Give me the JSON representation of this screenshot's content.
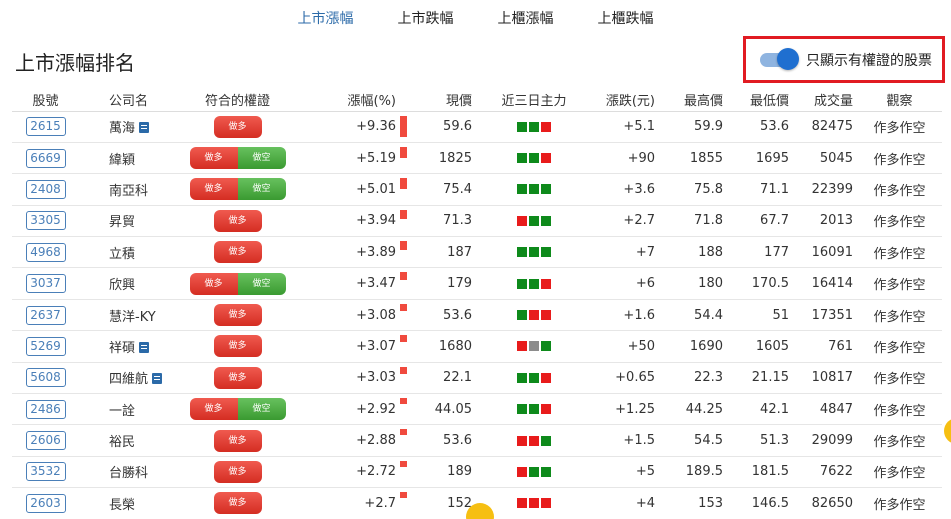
{
  "nav": {
    "tabs": [
      {
        "label": "上市漲幅",
        "active": true
      },
      {
        "label": "上市跌幅",
        "active": false
      },
      {
        "label": "上櫃漲幅",
        "active": false
      },
      {
        "label": "上櫃跌幅",
        "active": false
      }
    ]
  },
  "page_title": "上市漲幅排名",
  "toggle": {
    "label": "只顯示有權證的股票",
    "on": true
  },
  "table": {
    "headers": {
      "code": "股號",
      "name": "公司名",
      "warrant": "符合的權證",
      "pct": "漲幅(%)",
      "price": "現價",
      "main": "近三日主力",
      "chg": "漲跌(元)",
      "high": "最高價",
      "low": "最低價",
      "vol": "成交量",
      "view": "觀察"
    },
    "long_label": "做多",
    "short_label": "做空",
    "rows": [
      {
        "code": "2615",
        "name": "萬海",
        "doc": true,
        "warrants": [
          "long"
        ],
        "pct": "+9.36",
        "pct_value": 9.36,
        "price": "59.6",
        "main": [
          "g",
          "g",
          "r"
        ],
        "chg": "+5.1",
        "high": "59.9",
        "low": "53.6",
        "vol": "82475",
        "view": "作多作空"
      },
      {
        "code": "6669",
        "name": "緯穎",
        "doc": false,
        "warrants": [
          "long",
          "short"
        ],
        "pct": "+5.19",
        "pct_value": 5.19,
        "price": "1825",
        "main": [
          "g",
          "g",
          "r"
        ],
        "chg": "+90",
        "high": "1855",
        "low": "1695",
        "vol": "5045",
        "view": "作多作空"
      },
      {
        "code": "2408",
        "name": "南亞科",
        "doc": false,
        "warrants": [
          "long",
          "short"
        ],
        "pct": "+5.01",
        "pct_value": 5.01,
        "price": "75.4",
        "main": [
          "g",
          "g",
          "g"
        ],
        "chg": "+3.6",
        "high": "75.8",
        "low": "71.1",
        "vol": "22399",
        "view": "作多作空"
      },
      {
        "code": "3305",
        "name": "昇貿",
        "doc": false,
        "warrants": [
          "long"
        ],
        "pct": "+3.94",
        "pct_value": 3.94,
        "price": "71.3",
        "main": [
          "r",
          "g",
          "g"
        ],
        "chg": "+2.7",
        "high": "71.8",
        "low": "67.7",
        "vol": "2013",
        "view": "作多作空"
      },
      {
        "code": "4968",
        "name": "立積",
        "doc": false,
        "warrants": [
          "long"
        ],
        "pct": "+3.89",
        "pct_value": 3.89,
        "price": "187",
        "main": [
          "g",
          "g",
          "g"
        ],
        "chg": "+7",
        "high": "188",
        "low": "177",
        "vol": "16091",
        "view": "作多作空"
      },
      {
        "code": "3037",
        "name": "欣興",
        "doc": false,
        "warrants": [
          "long",
          "short"
        ],
        "pct": "+3.47",
        "pct_value": 3.47,
        "price": "179",
        "main": [
          "g",
          "g",
          "r"
        ],
        "chg": "+6",
        "high": "180",
        "low": "170.5",
        "vol": "16414",
        "view": "作多作空"
      },
      {
        "code": "2637",
        "name": "慧洋-KY",
        "doc": false,
        "warrants": [
          "long"
        ],
        "pct": "+3.08",
        "pct_value": 3.08,
        "price": "53.6",
        "main": [
          "g",
          "r",
          "r"
        ],
        "chg": "+1.6",
        "high": "54.4",
        "low": "51",
        "vol": "17351",
        "view": "作多作空"
      },
      {
        "code": "5269",
        "name": "祥碩",
        "doc": true,
        "warrants": [
          "long"
        ],
        "pct": "+3.07",
        "pct_value": 3.07,
        "price": "1680",
        "main": [
          "r",
          "gr",
          "g"
        ],
        "chg": "+50",
        "high": "1690",
        "low": "1605",
        "vol": "761",
        "view": "作多作空"
      },
      {
        "code": "5608",
        "name": "四維航",
        "doc": true,
        "warrants": [
          "long"
        ],
        "pct": "+3.03",
        "pct_value": 3.03,
        "price": "22.1",
        "main": [
          "g",
          "g",
          "r"
        ],
        "chg": "+0.65",
        "high": "22.3",
        "low": "21.15",
        "vol": "10817",
        "view": "作多作空"
      },
      {
        "code": "2486",
        "name": "一詮",
        "doc": false,
        "warrants": [
          "long",
          "short"
        ],
        "pct": "+2.92",
        "pct_value": 2.92,
        "price": "44.05",
        "main": [
          "g",
          "g",
          "r"
        ],
        "chg": "+1.25",
        "high": "44.25",
        "low": "42.1",
        "vol": "4847",
        "view": "作多作空"
      },
      {
        "code": "2606",
        "name": "裕民",
        "doc": false,
        "warrants": [
          "long"
        ],
        "pct": "+2.88",
        "pct_value": 2.88,
        "price": "53.6",
        "main": [
          "r",
          "r",
          "g"
        ],
        "chg": "+1.5",
        "high": "54.5",
        "low": "51.3",
        "vol": "29099",
        "view": "作多作空"
      },
      {
        "code": "3532",
        "name": "台勝科",
        "doc": false,
        "warrants": [
          "long"
        ],
        "pct": "+2.72",
        "pct_value": 2.72,
        "price": "189",
        "main": [
          "r",
          "g",
          "g"
        ],
        "chg": "+5",
        "high": "189.5",
        "low": "181.5",
        "vol": "7622",
        "view": "作多作空"
      },
      {
        "code": "2603",
        "name": "長榮",
        "doc": false,
        "warrants": [
          "long"
        ],
        "pct": "+2.7",
        "pct_value": 2.7,
        "price": "152",
        "main": [
          "r",
          "r",
          "r"
        ],
        "chg": "+4",
        "high": "153",
        "low": "146.5",
        "vol": "82650",
        "view": "作多作空"
      }
    ]
  },
  "colors": {
    "accent": "#2b6aa8",
    "highlight_border": "#e11b22",
    "long": "#e23a2f",
    "short": "#4aab40",
    "up_bar": "#f04a3e"
  }
}
